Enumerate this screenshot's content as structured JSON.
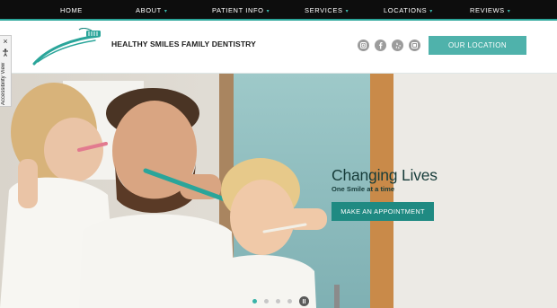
{
  "nav": {
    "items": [
      {
        "label": "HOME",
        "has_dropdown": false
      },
      {
        "label": "ABOUT",
        "has_dropdown": true
      },
      {
        "label": "PATIENT INFO",
        "has_dropdown": true
      },
      {
        "label": "SERVICES",
        "has_dropdown": true
      },
      {
        "label": "LOCATIONS",
        "has_dropdown": true
      },
      {
        "label": "REVIEWS",
        "has_dropdown": true
      }
    ],
    "dropdown_glyph": "▾"
  },
  "header": {
    "brand_name": "HEALTHY SMILES FAMILY DENTISTRY",
    "logo_icon": "toothbrush-logo-icon",
    "social_icons": [
      "instagram-icon",
      "facebook-icon",
      "yelp-icon",
      "google-icon"
    ],
    "location_button": "OUR LOCATION"
  },
  "hero": {
    "headline": "Changing Lives",
    "subheadline": "One Smile at a time",
    "cta": "MAKE AN APPOINTMENT",
    "slide_count": 4,
    "active_slide": 1,
    "pause_icon": "pause-icon"
  },
  "accessibility": {
    "close": "×",
    "label": "Accessibility View",
    "icon": "accessibility-person-icon"
  },
  "colors": {
    "nav_bg": "#0d0d0d",
    "accent": "#2aa59a",
    "button_light": "#4fb2ab",
    "button_dark": "#1f8a82",
    "headline_text": "#173c3a"
  }
}
